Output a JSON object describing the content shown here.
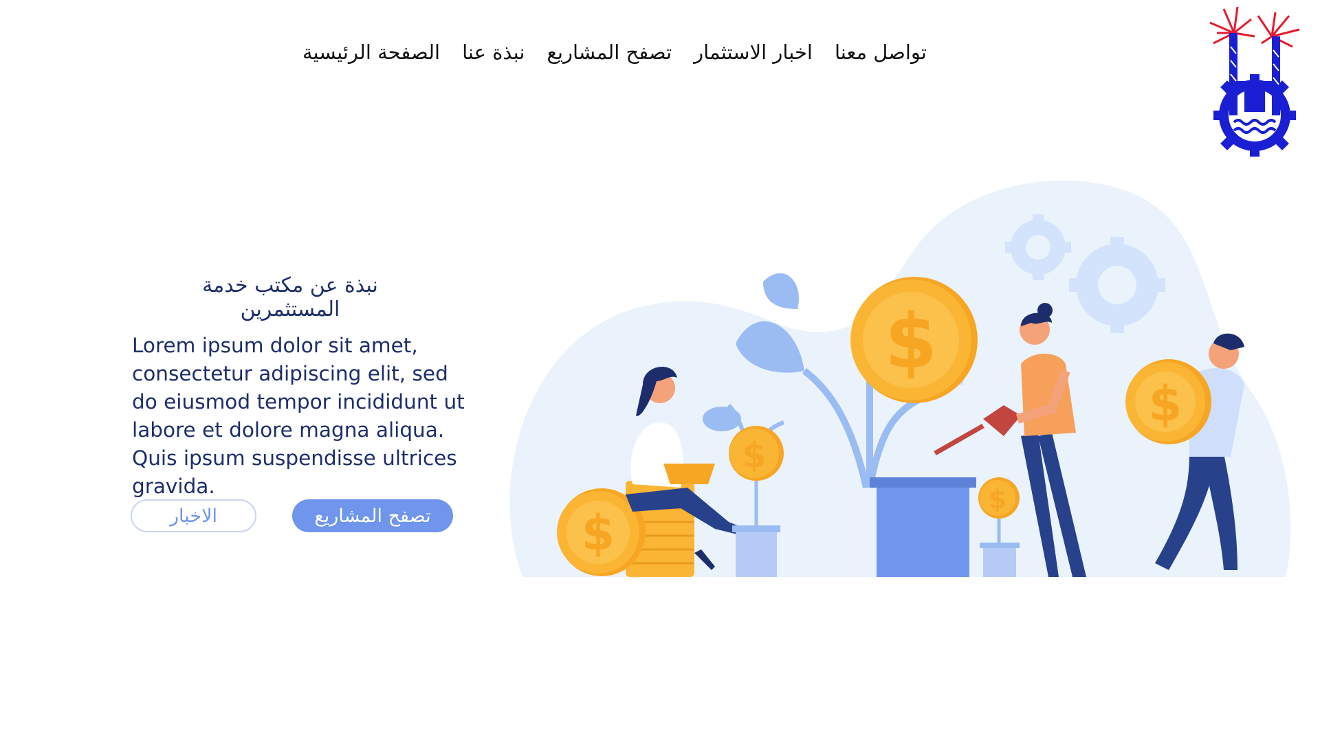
{
  "nav": {
    "home": "الصفحة الرئيسية",
    "about": "نبذة عنا",
    "browse_projects": "تصفح المشاريع",
    "investment_news": "اخبار الاستثمار",
    "contact": "تواصل معنا"
  },
  "hero": {
    "title": "نبذة عن مكتب خدمة المستثمرين",
    "body": "Lorem ipsum dolor sit amet, consectetur adipiscing elit, sed do eiusmod tempor incididunt ut labore et dolore magna aliqua. Quis ipsum suspendisse ultrices gravida.",
    "primary_button": "تصفح المشاريع",
    "secondary_button": "الاخبار"
  },
  "colors": {
    "accent": "#6f95ec",
    "text_dark": "#1d2d6b",
    "coin": "#fbb534",
    "blob": "#eaf2fb"
  },
  "icons": {
    "logo": "governorate-emblem-logo",
    "illustration": "investment-growth-illustration"
  }
}
